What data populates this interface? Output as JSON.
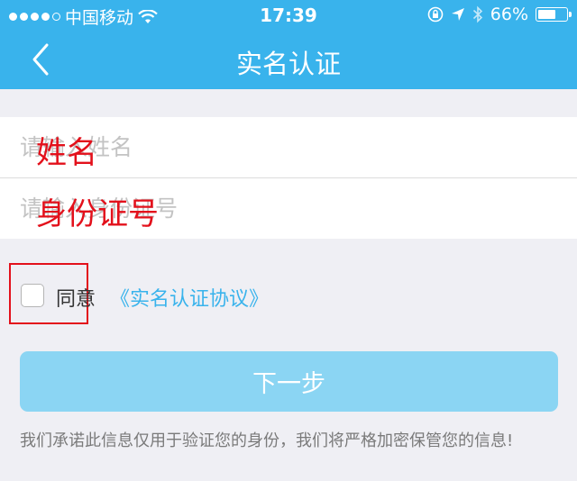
{
  "status_bar": {
    "carrier": "中国移动",
    "time": "17:39",
    "battery": "66%",
    "battery_level": 0.66,
    "icons": [
      "signal-dots-icon",
      "wifi-icon",
      "rotation-lock-icon",
      "location-icon",
      "bluetooth-icon",
      "battery-icon"
    ]
  },
  "nav": {
    "title": "实名认证",
    "back_icon": "chevron-left-icon"
  },
  "form": {
    "name_placeholder": "请输入姓名",
    "id_placeholder": "请输入身份证号",
    "name_overlay": "姓名",
    "id_overlay": "身份证号"
  },
  "agreement": {
    "agree_label": "同意",
    "link_text": "《实名认证协议》",
    "checked": false
  },
  "next_button": {
    "label": "下一步"
  },
  "footnote": "我们承诺此信息仅用于验证您的身份，我们将严格加密保管您的信息!",
  "colors": {
    "header": "#39b3ec",
    "link": "#39b3ec",
    "button": "#8bd5f3",
    "annotation": "#e3101b",
    "background": "#efeff4"
  }
}
